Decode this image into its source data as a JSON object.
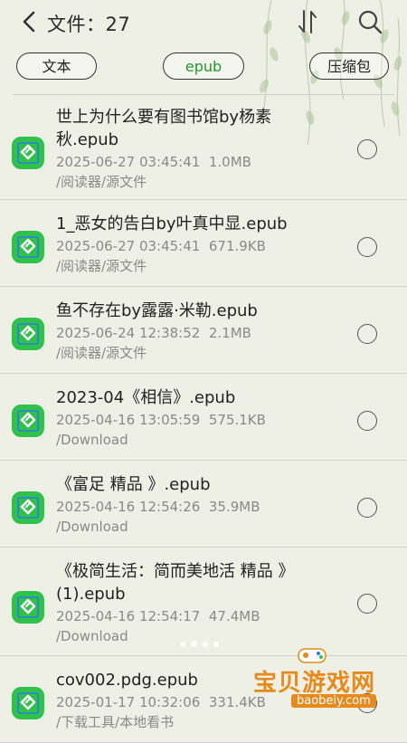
{
  "header": {
    "title": "文件：27"
  },
  "filters": [
    {
      "label": "文本",
      "active": false
    },
    {
      "label": "epub",
      "active": true
    },
    {
      "label": "压缩包",
      "active": false
    }
  ],
  "files": [
    {
      "name_lines": [
        "世上为什么要有图书馆by杨素",
        "秋.epub"
      ],
      "date": "2025-06-27 03:45:41",
      "size": "1.0MB",
      "path": "/阅读器/源文件"
    },
    {
      "name_lines": [
        "1_恶女的告白by叶真中显.epub"
      ],
      "date": "2025-06-27 03:45:41",
      "size": "671.9KB",
      "path": "/阅读器/源文件"
    },
    {
      "name_lines": [
        "鱼不存在by露露·米勒.epub"
      ],
      "date": "2025-06-24 12:38:52",
      "size": "2.1MB",
      "path": "/阅读器/源文件"
    },
    {
      "name_lines": [
        "2023-04《相信》.epub"
      ],
      "date": "2025-04-16 13:05:59",
      "size": "575.1KB",
      "path": "/Download"
    },
    {
      "name_lines": [
        "《富足 精品 》.epub"
      ],
      "date": "2025-04-16 12:54:26",
      "size": "35.9MB",
      "path": "/Download"
    },
    {
      "name_lines": [
        "《极简生活：简而美地活 精品 》",
        "(1).epub"
      ],
      "date": "2025-04-16 12:54:17",
      "size": "47.4MB",
      "path": "/Download"
    },
    {
      "name_lines": [
        "cov002.pdg.epub"
      ],
      "date": "2025-01-17 10:32:06",
      "size": "331.4KB",
      "path": "/下载工具/本地看书"
    }
  ],
  "watermark": {
    "text": "宝贝游戏网",
    "url": "baobeiy.com"
  },
  "colors": {
    "accent": "#1e9a2a",
    "icon_green": "#2fc24a",
    "icon_blue": "#2b7be0",
    "watermark": "#e78a1c"
  },
  "icons": {
    "back": "chevron-left-icon",
    "sort": "sort-arrows-icon",
    "search": "search-icon",
    "file": "epub-file-icon"
  }
}
